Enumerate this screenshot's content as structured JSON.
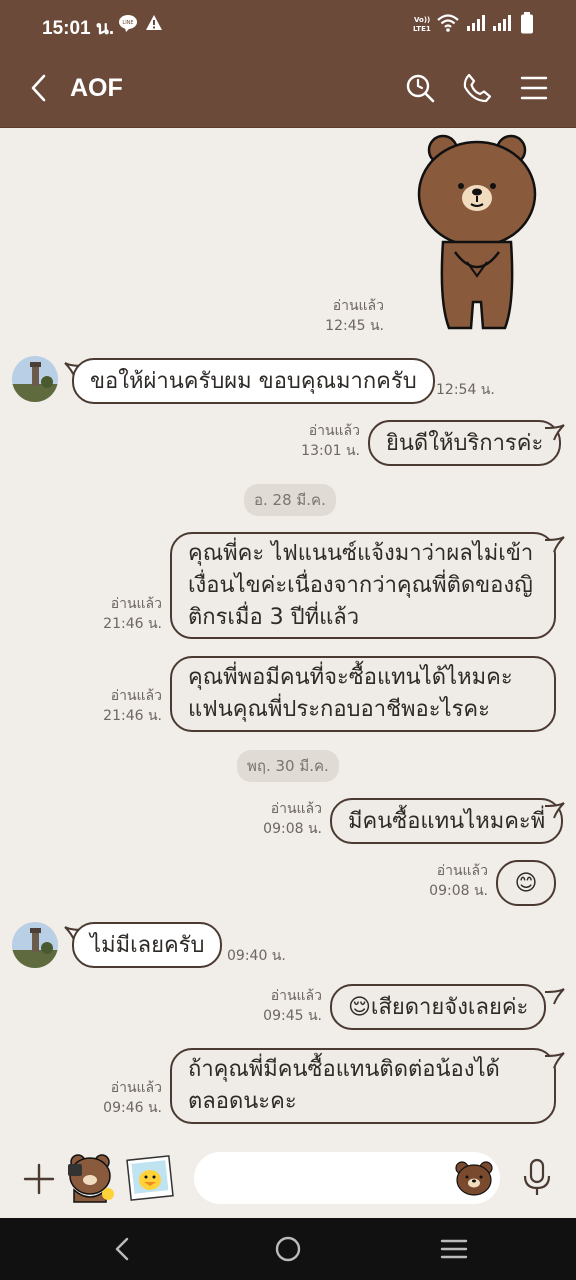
{
  "status_bar": {
    "time": "15:01 น.",
    "icons": [
      "line-icon",
      "alert-icon",
      "volte-icon",
      "wifi-icon",
      "signal-icon",
      "signal-icon",
      "battery-icon"
    ]
  },
  "header": {
    "title": "AOF",
    "icons": [
      "back-icon",
      "search-icon",
      "phone-icon",
      "menu-icon"
    ]
  },
  "messages": [
    {
      "type": "sticker",
      "side": "out",
      "sticker": "brown-bear-sticker",
      "read": "อ่านแล้ว",
      "time": "12:45 น."
    },
    {
      "type": "text",
      "side": "in",
      "text": "ขอให้ผ่านครับผม ขอบคุณมากครับ",
      "time": "12:54 น."
    },
    {
      "type": "text",
      "side": "out",
      "text": "ยินดีให้บริการค่ะ",
      "read": "อ่านแล้ว",
      "time": "13:01 น."
    },
    {
      "type": "date",
      "text": "อ. 28 มี.ค."
    },
    {
      "type": "text",
      "side": "out",
      "lines": [
        "คุณพี่คะ ไฟแนนซ์แจ้งมาว่าผลไม่เข้า",
        "เงื่อนไขค่ะเนื่องจากว่าคุณพี่ติดของญิ",
        "ติกรเมื่อ 3 ปีที่แล้ว"
      ],
      "read": "อ่านแล้ว",
      "time": "21:46 น."
    },
    {
      "type": "text",
      "side": "out",
      "lines": [
        "คุณพี่พอมีคนที่จะซื้อแทนได้ไหมคะ",
        "แฟนคุณพี่ประกอบอาชีพอะไรคะ"
      ],
      "read": "อ่านแล้ว",
      "time": "21:46 น."
    },
    {
      "type": "date",
      "text": "พฤ. 30 มี.ค."
    },
    {
      "type": "text",
      "side": "out",
      "text": "มีคนซื้อแทนไหมคะพี่",
      "read": "อ่านแล้ว",
      "time": "09:08 น."
    },
    {
      "type": "emoji",
      "side": "out",
      "text": "😊",
      "read": "อ่านแล้ว",
      "time": "09:08 น."
    },
    {
      "type": "text",
      "side": "in",
      "text": "ไม่มีเลยครับ",
      "time": "09:40 น."
    },
    {
      "type": "text",
      "side": "out",
      "text": "😌เสียดายจังเลยค่ะ",
      "read": "อ่านแล้ว",
      "time": "09:45 น."
    },
    {
      "type": "text",
      "side": "out",
      "lines": [
        "ถ้าคุณพี่มีคนซื้อแทนติดต่อน้องได้",
        "ตลอดนะคะ"
      ],
      "read": "อ่านแล้ว",
      "time": "09:46 น."
    }
  ],
  "input_bar": {
    "icons": [
      "plus-icon",
      "sticker-brown-icon",
      "sticker-sally-icon",
      "emoji-bear-icon",
      "mic-icon"
    ],
    "placeholder": ""
  },
  "nav_bar": {
    "icons": [
      "nav-back-icon",
      "nav-home-icon",
      "nav-recents-icon"
    ]
  },
  "colors": {
    "header_bg": "#6b4a3a",
    "chat_bg": "#f1ede8",
    "bubble_out_bg": "#efebe6",
    "bubble_in_bg": "#ffffff",
    "bubble_border": "#4a3a32",
    "navbar_bg": "#111111"
  }
}
